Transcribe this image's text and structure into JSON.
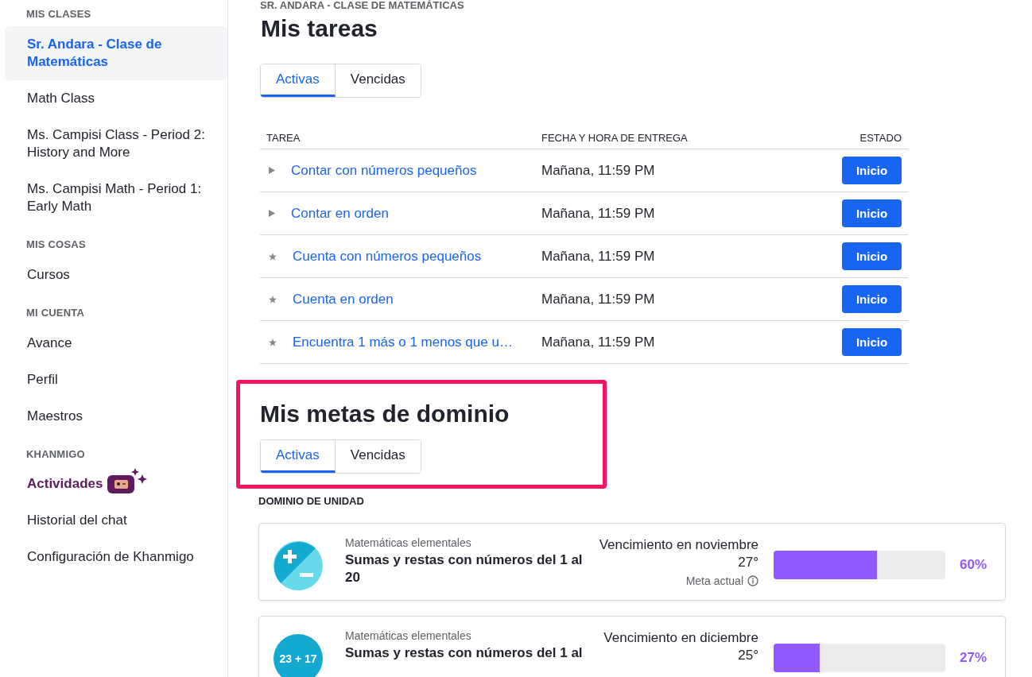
{
  "sidebar": {
    "sections": [
      {
        "heading": "MIS CLASES",
        "items": [
          {
            "label": "Sr. Andara - Clase de Matemáticas",
            "selected": true,
            "kind": "link"
          },
          {
            "label": "Math Class",
            "selected": false,
            "kind": "link"
          },
          {
            "label": "Ms. Campisi Class - Period 2: History and More",
            "selected": false,
            "kind": "link"
          },
          {
            "label": "Ms. Campisi Math - Period 1: Early Math",
            "selected": false,
            "kind": "link"
          }
        ]
      },
      {
        "heading": "MIS COSAS",
        "items": [
          {
            "label": "Cursos",
            "selected": false,
            "kind": "link"
          }
        ]
      },
      {
        "heading": "MI CUENTA",
        "items": [
          {
            "label": "Avance",
            "selected": false,
            "kind": "link"
          },
          {
            "label": "Perfil",
            "selected": false,
            "kind": "link"
          },
          {
            "label": "Maestros",
            "selected": false,
            "kind": "link"
          }
        ]
      },
      {
        "heading": "KHANMIGO",
        "items": [
          {
            "label": "Actividades",
            "selected": false,
            "kind": "khanmigo"
          },
          {
            "label": "Historial del chat",
            "selected": false,
            "kind": "link"
          },
          {
            "label": "Configuración de Khanmigo",
            "selected": false,
            "kind": "link"
          }
        ]
      }
    ]
  },
  "assignments": {
    "class_name": "SR. ANDARA - CLASE DE MATEMÁTICAS",
    "title": "Mis tareas",
    "tabs": [
      {
        "label": "Activas",
        "selected": true
      },
      {
        "label": "Vencidas",
        "selected": false
      }
    ],
    "table": {
      "columns": [
        "TAREA",
        "FECHA Y HORA DE ENTREGA",
        "ESTADO"
      ],
      "rows": [
        {
          "kind": "video",
          "title": "Contar con números pequeños",
          "due": "Mañana, 11:59 PM",
          "action": "Inicio"
        },
        {
          "kind": "video",
          "title": "Contar en orden",
          "due": "Mañana, 11:59 PM",
          "action": "Inicio"
        },
        {
          "kind": "exercise",
          "title": "Cuenta con números pequeños",
          "due": "Mañana, 11:59 PM",
          "action": "Inicio"
        },
        {
          "kind": "exercise",
          "title": "Cuenta en orden",
          "due": "Mañana, 11:59 PM",
          "action": "Inicio"
        },
        {
          "kind": "exercise",
          "title": "Encuentra 1 más o 1 menos que u…",
          "due": "Mañana, 11:59 PM",
          "action": "Inicio"
        }
      ]
    }
  },
  "mastery": {
    "title": "Mis metas de dominio",
    "highlighted": true,
    "tabs": [
      {
        "label": "Activas",
        "selected": true
      },
      {
        "label": "Vencidas",
        "selected": false
      }
    ],
    "section_label": "DOMINIO DE UNIDAD",
    "goals": [
      {
        "kind": "plus-minus",
        "course": "Matemáticas elementales",
        "unit": "Sumas y restas con números del 1 al 20",
        "due_line_1": "Vencimiento en noviembre",
        "due_line_2": "27°",
        "note": "Meta actual",
        "level": 0.6,
        "percent": "60%"
      },
      {
        "kind": "sum",
        "icon_text": "23 + 17",
        "course": "Matemáticas elementales",
        "unit": "Sumas y restas con números del 1 al",
        "due_line_1": "Vencimiento en diciembre",
        "due_line_2": "25°",
        "level": 0.27,
        "percent": "27%"
      }
    ]
  }
}
